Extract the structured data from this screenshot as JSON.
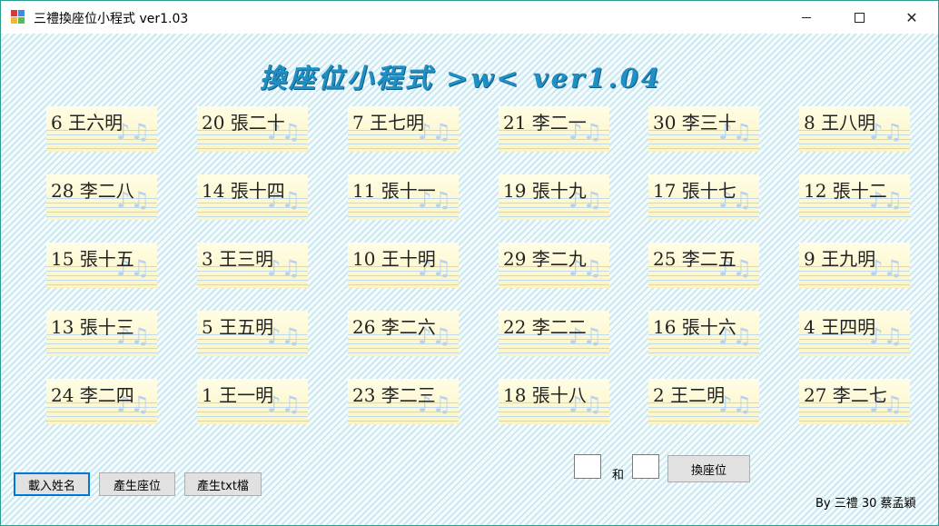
{
  "window": {
    "title": "三禮換座位小程式 ver1.03"
  },
  "banner": {
    "text": "換座位小程式 >w< ver1.04"
  },
  "seats": [
    "6 王六明",
    "20 張二十",
    "7 王七明",
    "21 李二一",
    "30 李三十",
    "8 王八明",
    "28 李二八",
    "14 張十四",
    "11 張十一",
    "19 張十九",
    "17 張十七",
    "12 張十二",
    "15 張十五",
    "3 王三明",
    "10 王十明",
    "29 李二九",
    "25 李二五",
    "9 王九明",
    "13 張十三",
    "5 王五明",
    "26 李二六",
    "22 李二二",
    "16 張十六",
    "4 王四明",
    "24 李二四",
    "1 王一明",
    "23 李二三",
    "18 張十八",
    "2 王二明",
    "27 李二七"
  ],
  "buttons": {
    "load_names": "載入姓名",
    "generate_seats": "產生座位",
    "generate_txt": "產生txt檔",
    "swap": "換座位"
  },
  "swap": {
    "and_label": "和",
    "first_value": "",
    "second_value": ""
  },
  "footer": {
    "credit": "By 三禮 30 蔡孟穎"
  },
  "colors": {
    "banner": "#1f8fc4",
    "focus_border": "#0078d7",
    "window_border": "#2a9d8f"
  }
}
